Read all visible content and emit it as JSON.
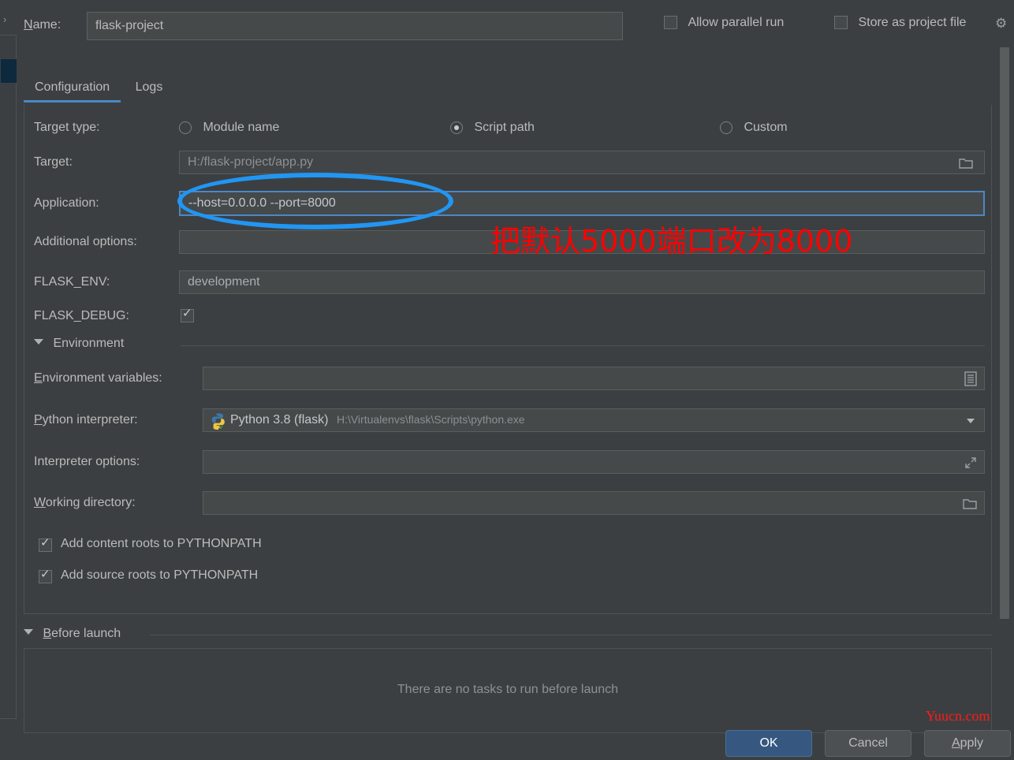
{
  "colors": {
    "background": "#3c3f41",
    "field_background": "#45494a",
    "accent_blue": "#4a88c7",
    "ok_button": "#365880",
    "annotation_blue": "#2196f3",
    "annotation_red": "#ff0000",
    "text": "#bbbbbb"
  },
  "sidebar": {
    "chevron_icon": "chevron-right-icon"
  },
  "header": {
    "name_label": "Name:",
    "name_value": "flask-project",
    "name_placeholder": "",
    "allow_parallel_run": {
      "label": "Allow parallel run",
      "checked": false
    },
    "store_as_project_file": {
      "label": "Store as project file",
      "checked": false
    },
    "gear_icon": "gear-icon"
  },
  "tabs": [
    {
      "label": "Configuration",
      "active": true
    },
    {
      "label": "Logs",
      "active": false
    }
  ],
  "form": {
    "target_type": {
      "label": "Target type:",
      "options": [
        {
          "label": "Module name",
          "selected": false
        },
        {
          "label": "Script path",
          "selected": true
        },
        {
          "label": "Custom",
          "selected": false
        }
      ]
    },
    "target": {
      "label": "Target:",
      "value": "H:/flask-project/app.py",
      "icon": "folder-icon"
    },
    "application": {
      "label": "Application:",
      "value": "--host=0.0.0.0 --port=8000",
      "focused": true
    },
    "additional_options": {
      "label": "Additional options:",
      "value": ""
    },
    "flask_env": {
      "label": "FLASK_ENV:",
      "value": "development"
    },
    "flask_debug": {
      "label": "FLASK_DEBUG:",
      "checked": true
    },
    "environment_section": {
      "label": "Environment",
      "expanded": true
    },
    "environment_variables": {
      "label": "Environment variables:",
      "value": "",
      "icon": "list-editor-icon"
    },
    "python_interpreter": {
      "label": "Python interpreter:",
      "value": "Python 3.8 (flask)",
      "path": "H:\\Virtualenvs\\flask\\Scripts\\python.exe",
      "icon": "python-venv-icon",
      "dropdown_icon": "chevron-down-icon"
    },
    "interpreter_options": {
      "label": "Interpreter options:",
      "value": "",
      "icon": "expand-icon"
    },
    "working_directory": {
      "label": "Working directory:",
      "value": "",
      "icon": "folder-icon"
    },
    "add_content_roots": {
      "label": "Add content roots to PYTHONPATH",
      "checked": true
    },
    "add_source_roots": {
      "label": "Add source roots to PYTHONPATH",
      "checked": true
    }
  },
  "before_launch": {
    "label": "Before launch",
    "expanded": true,
    "empty_message": "There are no tasks to run before launch"
  },
  "buttons": {
    "ok": "OK",
    "cancel": "Cancel",
    "apply": "Apply"
  },
  "annotations": {
    "red_note": "把默认5000端口改为8000",
    "ellipse": "blue-ellipse-highlight"
  },
  "watermark": "Yuucn.com"
}
